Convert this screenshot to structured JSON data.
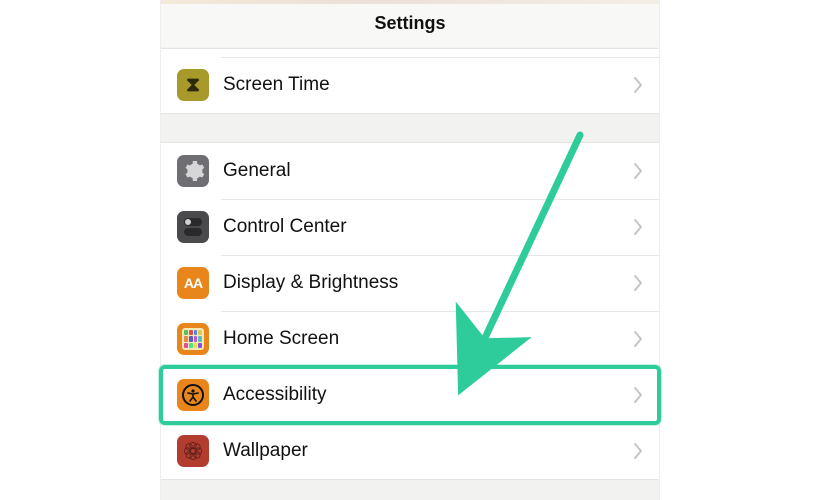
{
  "navbar": {
    "title": "Settings"
  },
  "groups": [
    {
      "partial_above": true,
      "items": [
        {
          "key": "screen-time",
          "label": "Screen Time",
          "icon": "hourglass-icon",
          "bg": "bg-olive"
        }
      ]
    },
    {
      "items": [
        {
          "key": "general",
          "label": "General",
          "icon": "gear-icon",
          "bg": "bg-gray"
        },
        {
          "key": "control-center",
          "label": "Control Center",
          "icon": "toggles-icon",
          "bg": "bg-dark"
        },
        {
          "key": "display-brightness",
          "label": "Display & Brightness",
          "icon": "aa-icon",
          "bg": "bg-orange"
        },
        {
          "key": "home-screen",
          "label": "Home Screen",
          "icon": "grid-icon",
          "bg": "bg-orange"
        },
        {
          "key": "accessibility",
          "label": "Accessibility",
          "icon": "accessibility-icon",
          "bg": "bg-orange"
        },
        {
          "key": "wallpaper",
          "label": "Wallpaper",
          "icon": "flower-icon",
          "bg": "bg-red"
        }
      ]
    }
  ],
  "annotation": {
    "highlight_target": "accessibility",
    "colors": {
      "highlight": "#2ecc9b",
      "arrow": "#2ecc9b"
    }
  },
  "grid_colors": [
    "#5cbf5c",
    "#e34d4d",
    "#4d8be3",
    "#e3c84d",
    "#e3894d",
    "#5c5cbf",
    "#bf5cbf",
    "#5cbfbf",
    "#e34d9a",
    "#4de38b",
    "#e3e34d",
    "#8b4de3"
  ]
}
